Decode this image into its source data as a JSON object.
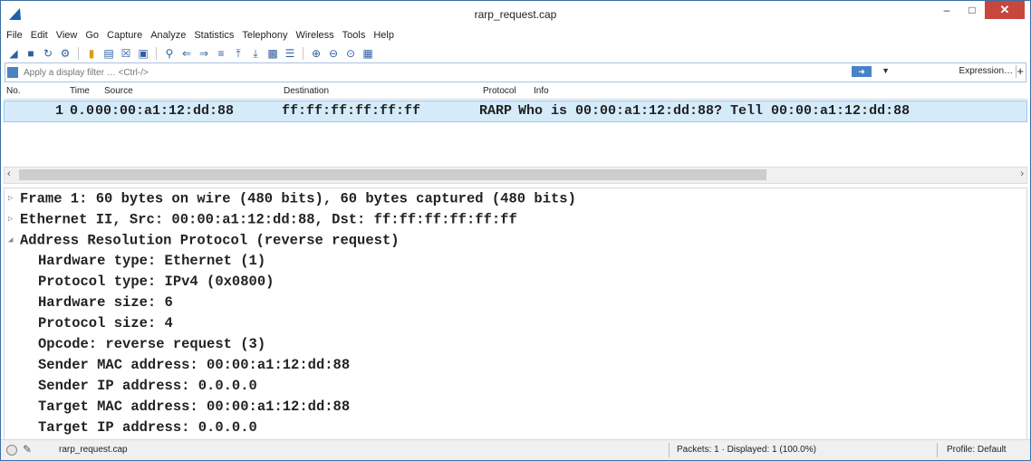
{
  "window": {
    "title": "rarp_request.cap"
  },
  "menu": [
    "File",
    "Edit",
    "View",
    "Go",
    "Capture",
    "Analyze",
    "Statistics",
    "Telephony",
    "Wireless",
    "Tools",
    "Help"
  ],
  "toolbar_icons": [
    "shark-fin-start",
    "stop",
    "restart",
    "options",
    "open",
    "save",
    "close",
    "reload",
    "find",
    "back",
    "forward",
    "goto",
    "first",
    "last",
    "autoscroll",
    "colorize",
    "zoom-in",
    "zoom-out",
    "zoom-normal",
    "resize-columns"
  ],
  "filter": {
    "placeholder": "Apply a display filter … <Ctrl-/>",
    "expression_label": "Expression…",
    "plus": "+"
  },
  "packet_list": {
    "columns": {
      "no": "No.",
      "time": "Time",
      "source": "Source",
      "destination": "Destination",
      "protocol": "Protocol",
      "info": "Info"
    },
    "rows": [
      {
        "no": "1",
        "time": "0.0",
        "source": "00:00:a1:12:dd:88",
        "destination": "ff:ff:ff:ff:ff:ff",
        "protocol": "RARP",
        "info": "Who is 00:00:a1:12:dd:88? Tell 00:00:a1:12:dd:88"
      }
    ]
  },
  "detail": {
    "frame": "Frame 1: 60 bytes on wire (480 bits), 60 bytes captured (480 bits)",
    "ethernet": "Ethernet II, Src: 00:00:a1:12:dd:88, Dst: ff:ff:ff:ff:ff:ff",
    "arp": "Address Resolution Protocol (reverse request)",
    "arp_fields": [
      "Hardware type: Ethernet (1)",
      "Protocol type: IPv4 (0x0800)",
      "Hardware size: 6",
      "Protocol size: 4",
      "Opcode: reverse request (3)",
      "Sender MAC address: 00:00:a1:12:dd:88",
      "Sender IP address: 0.0.0.0",
      "Target MAC address: 00:00:a1:12:dd:88",
      "Target IP address: 0.0.0.0"
    ]
  },
  "status": {
    "file": "rarp_request.cap",
    "packets": "Packets: 1 · Displayed: 1 (100.0%)",
    "profile": "Profile: Default"
  },
  "colors": {
    "selected_row": "#d6ebfa",
    "accent": "#4a83c4",
    "close_button": "#c7463e"
  }
}
